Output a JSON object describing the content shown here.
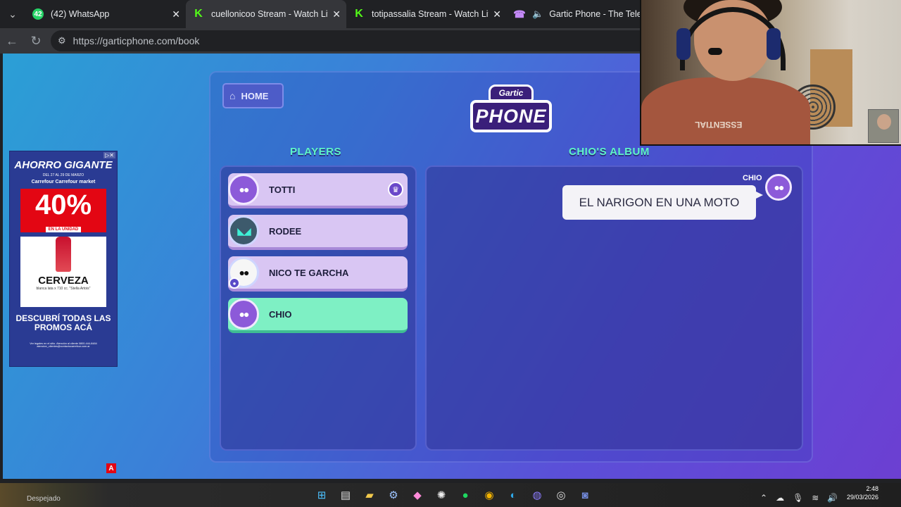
{
  "browser": {
    "tabs": [
      {
        "badge": "42",
        "title": "(42) WhatsApp",
        "active": false
      },
      {
        "title": "cuellonicoo Stream - Watch Live on",
        "active": true
      },
      {
        "title": "totipassalia Stream - Watch Live on",
        "active": false
      },
      {
        "title": "Gartic Phone - The Telephone",
        "active": false
      }
    ],
    "url": "https://garticphone.com/book"
  },
  "ad": {
    "headline": "AHORRO GIGANTE",
    "dates": "DEL 27 AL 29 DE MARZO",
    "brands": "Carrefour Carrefour market",
    "discount": "40%",
    "discount_sub": "EN LA UNIDAD",
    "product": "CERVEZA",
    "product_sub": "blanca lata x 710 cc. \"Stella Artois\"",
    "promo": "DESCUBRÍ TODAS LAS PROMOS ACÁ",
    "legal": "Ver legales en el sitio. Atención al cliente 0800-444-8484 atencion_clientes@contactocarrefour.com.ar",
    "badge": "A"
  },
  "game": {
    "home_label": "HOME",
    "logo_top": "Gartic",
    "logo_bottom": "PHONE",
    "players_title": "PLAYERS",
    "album_title": "CHIO'S ALBUM",
    "players": [
      {
        "name": "TOTTI",
        "avatar": "purple",
        "crown": true
      },
      {
        "name": "RODEE",
        "avatar": "teal"
      },
      {
        "name": "NICO TE GARCHA",
        "avatar": "panda",
        "badge": true
      },
      {
        "name": "CHIO",
        "avatar": "purple",
        "active": true
      }
    ],
    "album": {
      "author": "CHIO",
      "message": "EL NARIGON EN UNA MOTO"
    }
  },
  "webcam": {
    "shirt_text": "ESSENTIAL"
  },
  "taskbar": {
    "weather_text": "Despejado",
    "time": "2:48",
    "date": "29/03/2026"
  },
  "colors": {
    "accent_green": "#5ef5c6",
    "player_card": "#d9c6f3",
    "active_player": "#7ef0c4"
  }
}
